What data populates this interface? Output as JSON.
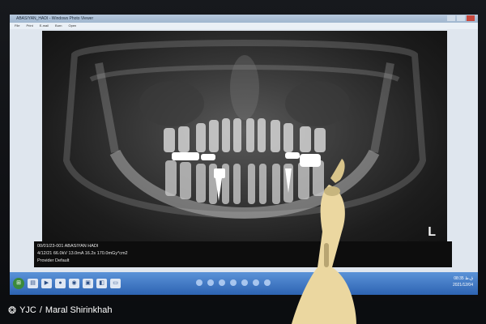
{
  "window": {
    "title": "ABASIYAN_HADI - Windows Photo Viewer",
    "menu": [
      "File",
      "Print",
      "E-mail",
      "Burn",
      "Open"
    ]
  },
  "viewer": {
    "orientation_marker": "L"
  },
  "patient_info": {
    "line1": "00/01/23-001   ABASIYAN HADI",
    "line2": "4/12/21 66.0kV 13.0mA 16.2s 170.0mGy*cm2",
    "line3": "Provider Default"
  },
  "taskbar": {
    "icons": [
      "start-orb-icon",
      "folder-icon",
      "media-player-icon",
      "firefox-icon",
      "chrome-icon",
      "photo-viewer-icon",
      "explorer-icon",
      "display-icon",
      "network-icon"
    ],
    "tray_time": "08:35 ق.ظ",
    "tray_date": "2021/12/04"
  },
  "credit": {
    "agency": "YJC",
    "photographer": "Maral Shirinkhah",
    "separator": "/"
  },
  "colors": {
    "taskbar_top": "#5b93d8",
    "taskbar_bottom": "#2d63b2",
    "xray_bone": "#d9d9d9",
    "filling": "#ffffff"
  }
}
